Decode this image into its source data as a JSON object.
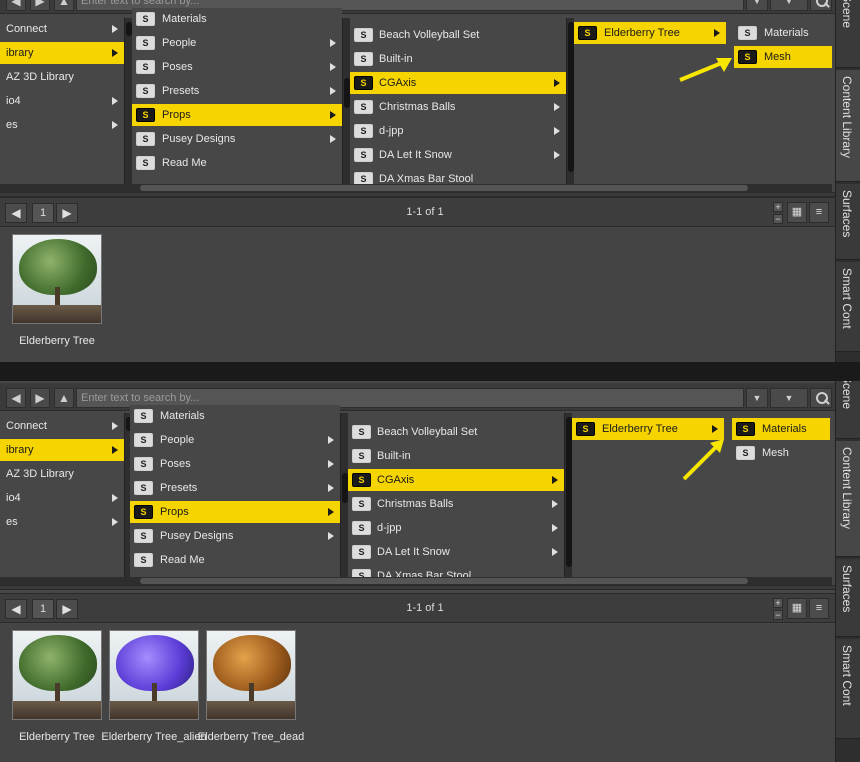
{
  "search_placeholder": "Enter text to search by...",
  "accent_color": "#f6d400",
  "columns": {
    "col1": [
      {
        "label": "Connect",
        "has_children": true
      },
      {
        "label": "ibrary",
        "has_children": true,
        "selected": true
      },
      {
        "label": "AZ 3D Library",
        "has_children": false
      },
      {
        "label": "io4",
        "has_children": true
      },
      {
        "label": "es",
        "has_children": true
      }
    ],
    "col1_top2": [
      {
        "label": "Connect",
        "has_children": true
      },
      {
        "label": "ibrary",
        "has_children": true,
        "selected": true
      },
      {
        "label": "AZ 3D Library",
        "has_children": false
      },
      {
        "label": "io4",
        "has_children": true
      },
      {
        "label": "es",
        "has_children": true
      }
    ],
    "col2": [
      {
        "label": "Materials",
        "has_children": false
      },
      {
        "label": "People",
        "has_children": true
      },
      {
        "label": "Poses",
        "has_children": true
      },
      {
        "label": "Presets",
        "has_children": true
      },
      {
        "label": "Props",
        "has_children": true,
        "selected": true
      },
      {
        "label": "Pusey Designs",
        "has_children": true
      },
      {
        "label": "Read Me",
        "has_children": false
      }
    ],
    "col3": [
      {
        "label": "Beach Volleyball Set",
        "has_children": false
      },
      {
        "label": "Built-in",
        "has_children": false
      },
      {
        "label": "CGAxis",
        "has_children": true,
        "selected": true
      },
      {
        "label": "Christmas Balls",
        "has_children": true
      },
      {
        "label": "d-jpp",
        "has_children": true
      },
      {
        "label": "DA Let It Snow",
        "has_children": true
      },
      {
        "label": "DA Xmas Bar Stool",
        "has_children": false
      }
    ],
    "col4": [
      {
        "label": "Elderberry Tree",
        "has_children": true,
        "selected": true
      }
    ],
    "col5_panel1": [
      {
        "label": "Materials",
        "selected": false
      },
      {
        "label": "Mesh",
        "selected": true
      }
    ],
    "col5_panel2": [
      {
        "label": "Materials",
        "selected": true
      },
      {
        "label": "Mesh",
        "selected": false
      }
    ]
  },
  "pager": {
    "page": "1",
    "info": "1-1 of 1"
  },
  "tiles_panel1": [
    {
      "label": "Elderberry Tree",
      "variant": "green"
    }
  ],
  "tiles_panel2": [
    {
      "label": "Elderberry Tree",
      "variant": "green"
    },
    {
      "label": "Elderberry Tree_alien",
      "variant": "purple"
    },
    {
      "label": "Elderberry Tree_dead",
      "variant": "orange"
    }
  ],
  "side_tabs": [
    "Scene",
    "Content Library",
    "Surfaces",
    "Smart Cont"
  ],
  "icons": {
    "back": "back-arrow-icon",
    "forward": "forward-arrow-icon",
    "up": "up-arrow-icon",
    "search": "magnifier-icon",
    "folder": "folder-icon"
  }
}
